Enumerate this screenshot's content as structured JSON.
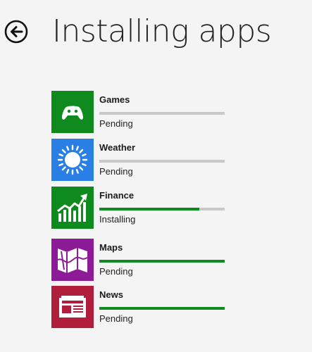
{
  "header": {
    "title": "Installing apps",
    "back_icon": "back-arrow-icon"
  },
  "apps": [
    {
      "name": "Games",
      "status": "Pending",
      "icon": "controller-icon",
      "tile_color": "#0e8a1e",
      "progress": 0,
      "bar_color": "#c8c8c8"
    },
    {
      "name": "Weather",
      "status": "Pending",
      "icon": "sun-icon",
      "tile_color": "#2a7fe4",
      "progress": 0,
      "bar_color": "#c8c8c8"
    },
    {
      "name": "Finance",
      "status": "Installing",
      "icon": "chart-icon",
      "tile_color": "#0e8a1e",
      "progress": 0.8,
      "bar_color": "#0e8a1e"
    },
    {
      "name": "Maps",
      "status": "Pending",
      "icon": "map-icon",
      "tile_color": "#8d1a96",
      "progress": 1,
      "bar_color": "#0e8a1e"
    },
    {
      "name": "News",
      "status": "Pending",
      "icon": "newspaper-icon",
      "tile_color": "#b01e3c",
      "progress": 1,
      "bar_color": "#0e8a1e"
    }
  ]
}
